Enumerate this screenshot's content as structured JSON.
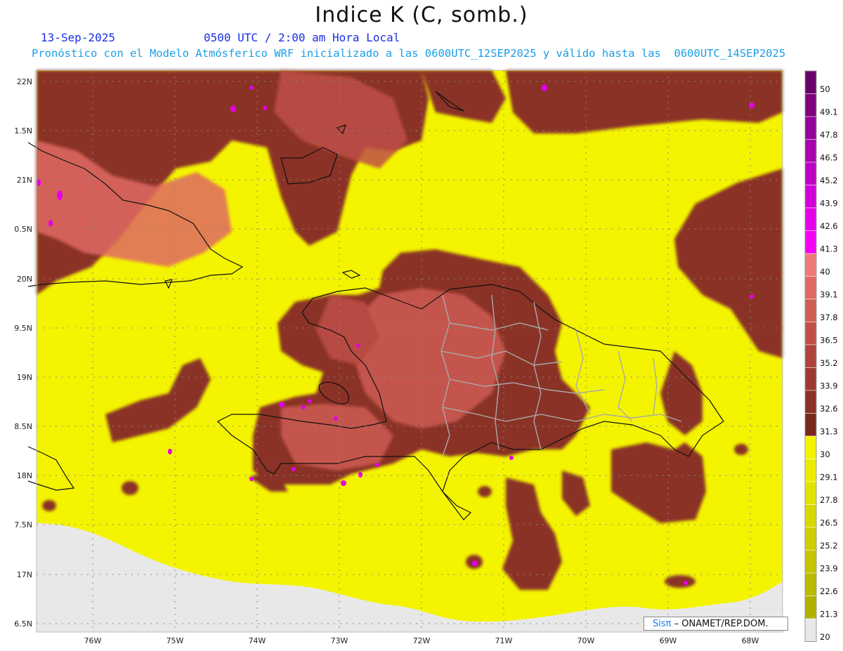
{
  "header": {
    "title": "Indice K (C, somb.)",
    "date": "13-Sep-2025",
    "time": "0500 UTC / 2:00 am Hora Local",
    "subtitle": "Pronóstico con el Modelo Atmósferico WRF inicializado a las 0600UTC_12SEP2025 y válido hasta las  0600UTC_14SEP2025"
  },
  "axes": {
    "lat_labels": [
      "22N",
      "1.5N",
      "21N",
      "0.5N",
      "20N",
      "9.5N",
      "19N",
      "8.5N",
      "18N",
      "7.5N",
      "17N",
      "6.5N"
    ],
    "lon_labels": [
      "76W",
      "75W",
      "74W",
      "73W",
      "72W",
      "71W",
      "70W",
      "69W",
      "68W"
    ]
  },
  "colorbar": {
    "labels": [
      "50",
      "49.1",
      "47.8",
      "46.5",
      "45.2",
      "43.9",
      "42.6",
      "41.3",
      "40",
      "39.1",
      "37.8",
      "36.5",
      "35.2",
      "33.9",
      "32.6",
      "31.3",
      "30",
      "29.1",
      "27.8",
      "26.5",
      "25.2",
      "23.9",
      "22.6",
      "21.3",
      "20"
    ],
    "colors": {
      "purple_band": [
        "#6a006a",
        "#7f007f",
        "#94009a",
        "#a800ae",
        "#be00c4",
        "#d200d8",
        "#e400e8",
        "#f400f4"
      ],
      "red_band": [
        "#f07a7a",
        "#e06a62",
        "#cf5c52",
        "#bf5046",
        "#ae443a",
        "#9c3a30",
        "#8a3026",
        "#7a281e"
      ],
      "yellow_band": [
        "#f4f400",
        "#ecec00",
        "#e2e200",
        "#d8d800",
        "#cece00",
        "#c4c400",
        "#babb00",
        "#b0b200"
      ],
      "below_range": "#e8e8e8"
    }
  },
  "credit": {
    "sis": "Sisπ",
    "text": " – ONAMET/REP.DOM."
  }
}
